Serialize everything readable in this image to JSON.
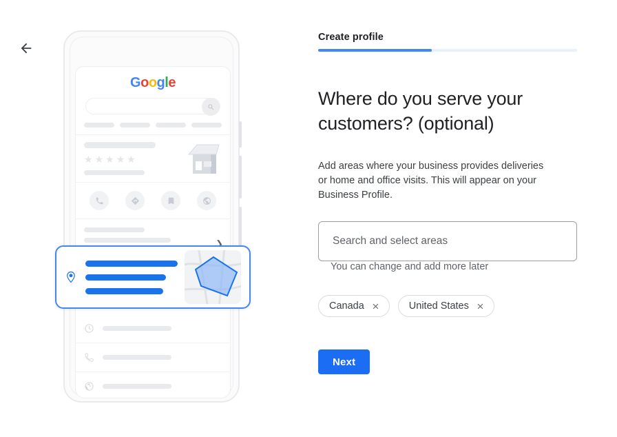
{
  "nav": {
    "back_label": "Back",
    "back_icon": "arrow-left-icon"
  },
  "wizard": {
    "step_label": "Create profile",
    "progress_percent": 44
  },
  "content": {
    "headline": "Where do you serve your customers? (optional)",
    "body": "Add areas where your business provides deliveries or home and office visits. This will appear on your Business Profile.",
    "search": {
      "placeholder": "Search and select areas",
      "value": ""
    },
    "helper_text": "You can change and add more later",
    "chips": [
      {
        "label": "Canada",
        "remove_icon": "close-icon"
      },
      {
        "label": "United States",
        "remove_icon": "close-icon"
      }
    ],
    "next_label": "Next"
  },
  "illustration": {
    "name": "phone-service-area-illustration",
    "google_logo": {
      "letters": [
        {
          "char": "G",
          "color": "#4285f4"
        },
        {
          "char": "o",
          "color": "#ea4335"
        },
        {
          "char": "o",
          "color": "#fbbc05"
        },
        {
          "char": "g",
          "color": "#4285f4"
        },
        {
          "char": "l",
          "color": "#34a853"
        },
        {
          "char": "e",
          "color": "#ea4335"
        }
      ]
    },
    "search_icon": "search-icon",
    "rating_stars": 5,
    "action_icons": [
      "phone-icon",
      "directions-icon",
      "bookmark-icon",
      "share-icon"
    ],
    "list_icons": [
      "clock-icon",
      "phone-icon",
      "globe-icon"
    ],
    "service_card": {
      "pin_icon": "location-pin-icon",
      "map_icon": "map-polygon-icon",
      "accent_color": "#4285f4"
    }
  },
  "colors": {
    "accent_blue": "#4285f4",
    "button_blue": "#1b6ef3",
    "progress_track": "#e8f0fe",
    "text_primary": "#202124",
    "text_secondary": "#5f6368",
    "border_gray": "#dadce0"
  }
}
